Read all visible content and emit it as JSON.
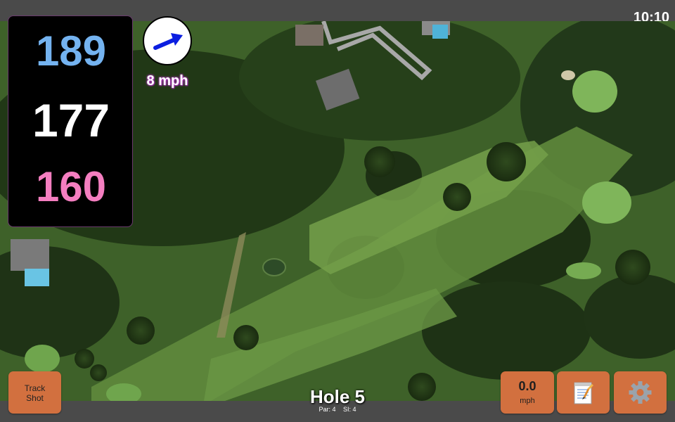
{
  "status_bar": {
    "time": "10:10"
  },
  "distances": {
    "back": "189",
    "center": "177",
    "front": "160",
    "colors": {
      "back": "#74b3f0",
      "center": "#ffffff",
      "front": "#f47ec0"
    }
  },
  "wind": {
    "speed": "8 mph",
    "icon": "wind-arrow-icon"
  },
  "hole": {
    "title": "Hole 5",
    "par_label": "Par: 4",
    "si_label": "SI: 4"
  },
  "buttons": {
    "track_shot": {
      "line1": "Track",
      "line2": "Shot"
    },
    "speed": {
      "value": "0.0",
      "unit": "mph"
    },
    "notes": {
      "icon": "notepad-icon"
    },
    "settings": {
      "icon": "gear-icon"
    }
  },
  "colors": {
    "button": "#d2703f",
    "bar": "#4a4a4a",
    "fairway": "#5f8a3c"
  }
}
